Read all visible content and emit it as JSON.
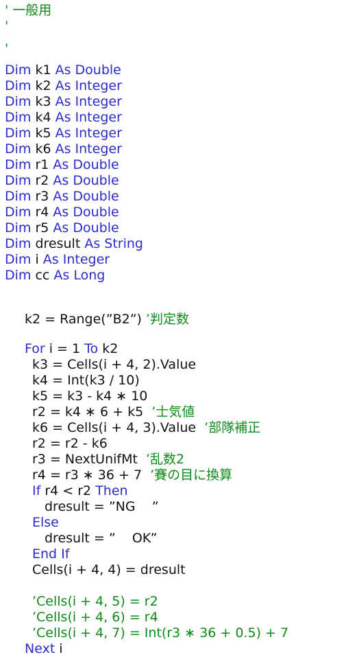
{
  "editor": {
    "title": "VBA code listing",
    "colors": {
      "keyword": "#2B2BCC",
      "plain": "#111111",
      "comment": "#0E8A18",
      "background": "#FFFFFF"
    }
  },
  "header_comments": [
    {
      "mark": "'",
      "text": " 一般用"
    },
    {
      "mark": "'",
      "text": ""
    },
    {
      "mark": "'",
      "text": ""
    }
  ],
  "declarations": [
    {
      "kw_dim": "Dim",
      "name": " k1 ",
      "kw_as": "As",
      "type": " Double"
    },
    {
      "kw_dim": "Dim",
      "name": " k2 ",
      "kw_as": "As",
      "type": " Integer"
    },
    {
      "kw_dim": "Dim",
      "name": " k3 ",
      "kw_as": "As",
      "type": " Integer"
    },
    {
      "kw_dim": "Dim",
      "name": " k4 ",
      "kw_as": "As",
      "type": " Integer"
    },
    {
      "kw_dim": "Dim",
      "name": " k5 ",
      "kw_as": "As",
      "type": " Integer"
    },
    {
      "kw_dim": "Dim",
      "name": " k6 ",
      "kw_as": "As",
      "type": " Integer"
    },
    {
      "kw_dim": "Dim",
      "name": " r1 ",
      "kw_as": "As",
      "type": " Double"
    },
    {
      "kw_dim": "Dim",
      "name": " r2 ",
      "kw_as": "As",
      "type": " Double"
    },
    {
      "kw_dim": "Dim",
      "name": " r3 ",
      "kw_as": "As",
      "type": " Double"
    },
    {
      "kw_dim": "Dim",
      "name": " r4 ",
      "kw_as": "As",
      "type": " Double"
    },
    {
      "kw_dim": "Dim",
      "name": " r5 ",
      "kw_as": "As",
      "type": " Double"
    },
    {
      "kw_dim": "Dim",
      "name": " dresult ",
      "kw_as": "As",
      "type": " String"
    },
    {
      "kw_dim": "Dim",
      "name": " i ",
      "kw_as": "As",
      "type": " Integer"
    },
    {
      "kw_dim": "Dim",
      "name": " cc ",
      "kw_as": "As",
      "type": " Long"
    }
  ],
  "body": {
    "assign_k2": {
      "code": "k2 = Range(”B2”)",
      "comment": " ’判定数"
    },
    "for_open": {
      "kw_for": "For",
      "mid": " i = 1 ",
      "kw_to": "To",
      "tail": " k2"
    },
    "stmt_k3": {
      "code": "k3 = Cells(i + 4, 2).Value",
      "comment": ""
    },
    "stmt_k4": {
      "code": "k4 = Int(k3 / 10)",
      "comment": ""
    },
    "stmt_k5": {
      "code": "k5 = k3 - k4 ∗ 10",
      "comment": ""
    },
    "stmt_r2a": {
      "code": "r2 = k4 ∗ 6 + k5",
      "comment": "  ’士気値"
    },
    "stmt_k6": {
      "code": "k6 = Cells(i + 4, 3).Value",
      "comment": "  ’部隊補正"
    },
    "stmt_r2b": {
      "code": "r2 = r2 - k6",
      "comment": ""
    },
    "stmt_r3": {
      "code": "r3 = NextUnifMt",
      "comment": "  ’乱数2"
    },
    "stmt_r4": {
      "code": "r4 = r3 ∗ 36 + 7",
      "comment": "  ’賽の目に換算"
    },
    "if_open": {
      "kw_if": "If",
      "mid": " r4 < r2 ",
      "kw_then": "Then"
    },
    "dresult_ng": {
      "code": "dresult = ”NG    ”"
    },
    "kw_else": "Else",
    "dresult_ok": {
      "code": "dresult = ”    OK”"
    },
    "kw_endif": "End If",
    "stmt_cells": {
      "code": "Cells(i + 4, 4) = dresult"
    },
    "commented_out": [
      "’Cells(i + 4, 5) = r2",
      "’Cells(i + 4, 6) = r4",
      "’Cells(i + 4, 7) = Int(r3 ∗ 36 + 0.5) + 7"
    ],
    "next_line": {
      "kw_next": "Next",
      "tail": " i"
    }
  }
}
